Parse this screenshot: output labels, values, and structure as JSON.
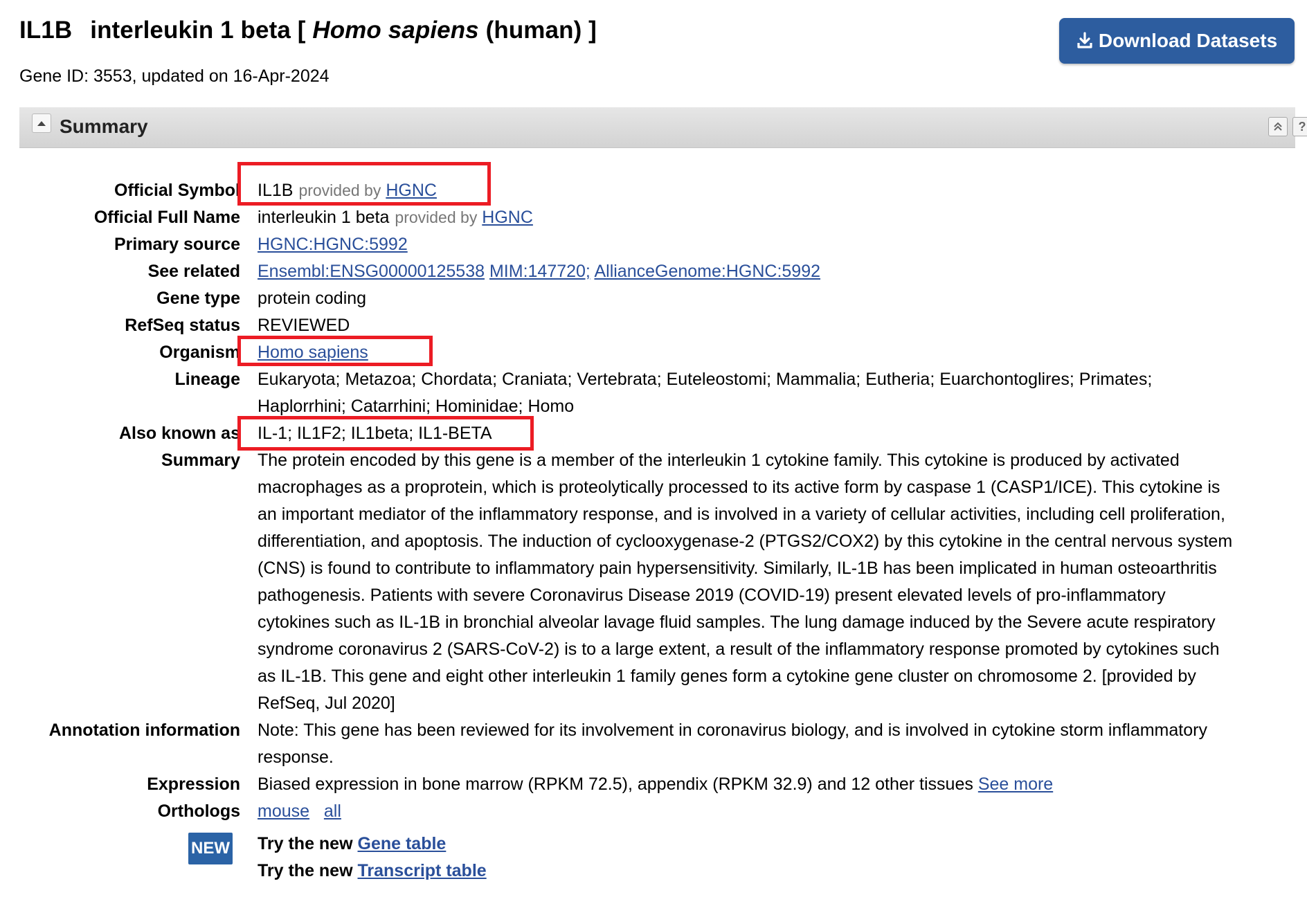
{
  "header": {
    "symbol": "IL1B",
    "name_prefix": "interleukin 1 beta [",
    "organism_italic": "Homo sapiens",
    "name_suffix": "(human) ]",
    "gene_id_line": "Gene ID: 3553, updated on 16-Apr-2024",
    "download_label": "Download Datasets"
  },
  "summary_section": {
    "title": "Summary",
    "help_glyph": "?"
  },
  "fields": {
    "official_symbol": {
      "label": "Official Symbol",
      "value": "IL1B",
      "provided": "provided by",
      "link": "HGNC"
    },
    "official_full_name": {
      "label": "Official Full Name",
      "value": "interleukin 1 beta",
      "provided": "provided by",
      "link": "HGNC"
    },
    "primary_source": {
      "label": "Primary source",
      "link": "HGNC:HGNC:5992"
    },
    "see_related": {
      "label": "See related",
      "links": [
        "Ensembl:ENSG00000125538",
        "MIM:147720;",
        "AllianceGenome:HGNC:5992"
      ]
    },
    "gene_type": {
      "label": "Gene type",
      "value": "protein coding"
    },
    "refseq_status": {
      "label": "RefSeq status",
      "value": "REVIEWED"
    },
    "organism": {
      "label": "Organism",
      "link": "Homo sapiens"
    },
    "lineage": {
      "label": "Lineage",
      "line1": "Eukaryota; Metazoa; Chordata; Craniata; Vertebrata; Euteleostomi; Mammalia; Eutheria; Euarchontoglires; Primates;",
      "line2": "Haplorrhini; Catarrhini; Hominidae; Homo"
    },
    "also_known_as": {
      "label": "Also known as",
      "value": "IL-1; IL1F2; IL1beta; IL1-BETA"
    },
    "summary": {
      "label": "Summary",
      "lines": [
        "The protein encoded by this gene is a member of the interleukin 1 cytokine family. This cytokine is produced by activated",
        "macrophages as a proprotein, which is proteolytically processed to its active form by caspase 1 (CASP1/ICE). This cytokine is",
        "an important mediator of the inflammatory response, and is involved in a variety of cellular activities, including cell proliferation,",
        "differentiation, and apoptosis. The induction of cyclooxygenase-2 (PTGS2/COX2) by this cytokine in the central nervous system",
        "(CNS) is found to contribute to inflammatory pain hypersensitivity. Similarly, IL-1B has been implicated in human osteoarthritis",
        "pathogenesis. Patients with severe Coronavirus Disease 2019 (COVID-19) present elevated levels of pro-inflammatory",
        "cytokines such as IL-1B in bronchial alveolar lavage fluid samples. The lung damage induced by the Severe acute respiratory",
        "syndrome coronavirus 2 (SARS-CoV-2) is to a large extent, a result of the inflammatory response promoted by cytokines such",
        "as IL-1B. This gene and eight other interleukin 1 family genes form a cytokine gene cluster on chromosome 2. [provided by",
        "RefSeq, Jul 2020]"
      ]
    },
    "annotation": {
      "label": "Annotation information",
      "line1": "Note: This gene has been reviewed for its involvement in coronavirus biology, and is involved in cytokine storm inflammatory",
      "line2": "response."
    },
    "expression": {
      "label": "Expression",
      "value": "Biased expression in bone marrow (RPKM 72.5), appendix (RPKM 32.9) and 12 other tissues",
      "link": "See more"
    },
    "orthologs": {
      "label": "Orthologs",
      "links": [
        "mouse",
        "all"
      ]
    }
  },
  "new_section": {
    "badge": "NEW",
    "try_prefix": "Try the new",
    "gene_table_link": "Gene table",
    "transcript_table_link": "Transcript table"
  },
  "colors": {
    "link": "#2a4f9a",
    "highlight": "#ec1c24",
    "button": "#2d5d9f"
  }
}
